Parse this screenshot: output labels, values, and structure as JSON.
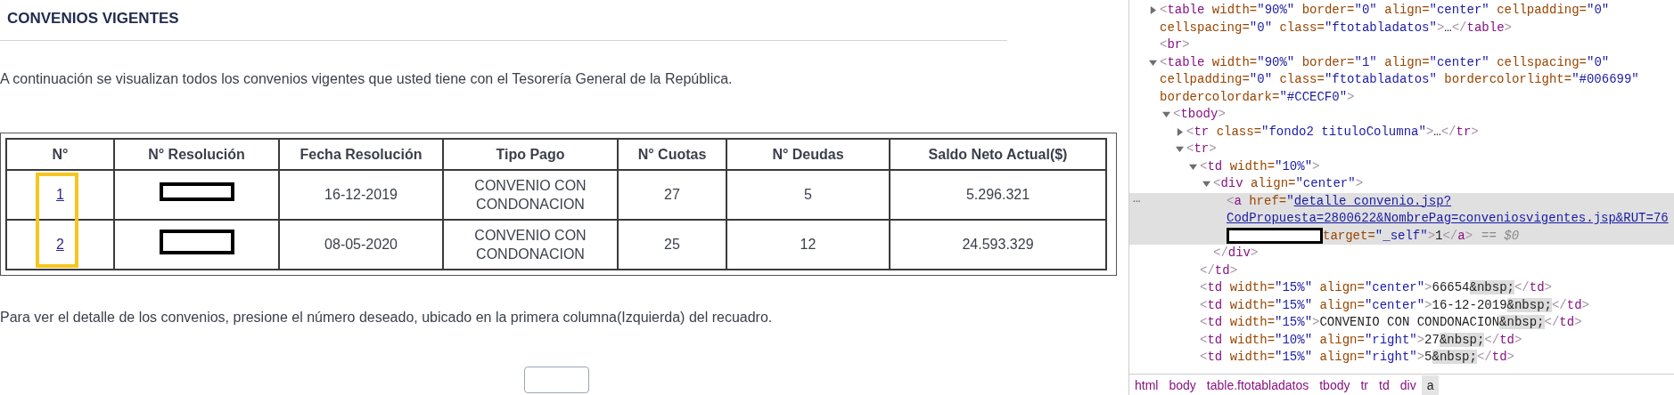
{
  "page": {
    "title": "CONVENIOS VIGENTES",
    "intro": "A continuación se visualizan todos los convenios vigentes que usted tiene con el Tesorería General de la República.",
    "table": {
      "columns": [
        "N°",
        "N° Resolución",
        "Fecha Resolución",
        "Tipo Pago",
        "N° Cuotas",
        "N° Deudas",
        "Saldo Neto Actual($)"
      ],
      "rows": [
        {
          "number": "1",
          "resolution_redacted": true,
          "date": "16-12-2019",
          "payment_type": "CONVENIO CON CONDONACION",
          "installments": "27",
          "debts": "5",
          "balance": "5.296.321"
        },
        {
          "number": "2",
          "resolution_redacted": true,
          "date": "08-05-2020",
          "payment_type": "CONVENIO CON CONDONACION",
          "installments": "25",
          "debts": "12",
          "balance": "24.593.329"
        }
      ],
      "first_column_highlighted": true
    },
    "note": "Para ver el detalle de los convenios, presione el número deseado, ubicado en la primera columna(Izquierda) del recuadro."
  },
  "devtools": {
    "tree": [
      {
        "kind": "element",
        "lines": [
          "<table width=\"90%\" border=\"0\" align=\"center\" cellpadding=\"0\"",
          "cellspacing=\"0\" class=\"ftotabladatos\">…</table>"
        ],
        "expanded": false,
        "selected": false
      },
      {
        "kind": "element",
        "lines": [
          "<br>"
        ],
        "selected": false
      },
      {
        "kind": "element",
        "lines": [
          "<table width=\"90%\" border=\"1\" align=\"center\" cellspacing=\"0\"",
          "cellpadding=\"0\" class=\"ftotabladatos\" bordercolorlight=\"#006699\"",
          "bordercolordark=\"#CCECF0\">"
        ],
        "expanded": true,
        "selected": false,
        "children": [
          {
            "kind": "element",
            "lines": [
              "<tbody>"
            ],
            "expanded": true,
            "selected": false,
            "children": [
              {
                "kind": "element",
                "lines": [
                  "<tr class=\"fondo2 tituloColumna\">…</tr>"
                ],
                "expanded": false,
                "selected": false
              },
              {
                "kind": "element",
                "lines": [
                  "<tr>"
                ],
                "expanded": true,
                "selected": false,
                "children": [
                  {
                    "kind": "element",
                    "lines": [
                      "<td width=\"10%\">"
                    ],
                    "expanded": true,
                    "selected": false,
                    "close": "</td>",
                    "children": [
                      {
                        "kind": "element",
                        "lines": [
                          "<div align=\"center\">"
                        ],
                        "expanded": true,
                        "selected": false,
                        "close": "</div>",
                        "children": [
                          {
                            "kind": "link",
                            "gutter_marker": "…",
                            "before": "<a href=\"",
                            "link_lines": [
                              "detalle_convenio.jsp?",
                              "CodPropuesta=2800622&NombrePag=conveniosvigentes.jsp&RUT=76"
                            ],
                            "redacted": true,
                            "after": "target=\"_self\">1</a>",
                            "console_ref": "== $0",
                            "selected": true
                          }
                        ]
                      }
                    ]
                  },
                  {
                    "kind": "element",
                    "lines": [
                      "<td width=\"15%\" align=\"center\">66654&nbsp;</td>"
                    ],
                    "selected": false
                  },
                  {
                    "kind": "element",
                    "lines": [
                      "<td width=\"15%\" align=\"center\">16-12-2019&nbsp;</td>"
                    ],
                    "selected": false
                  },
                  {
                    "kind": "element",
                    "lines": [
                      "<td width=\"15%\">CONVENIO CON CONDONACION&nbsp;</td>"
                    ],
                    "selected": false
                  },
                  {
                    "kind": "element",
                    "lines": [
                      "<td width=\"10%\" align=\"right\">27&nbsp;</td>"
                    ],
                    "selected": false
                  },
                  {
                    "kind": "element",
                    "lines": [
                      "<td width=\"15%\" align=\"right\">5&nbsp;</td>"
                    ],
                    "selected": false
                  }
                ]
              }
            ]
          }
        ]
      }
    ],
    "breadcrumbs": [
      {
        "label": "html",
        "selected": false
      },
      {
        "label": "body",
        "selected": false
      },
      {
        "label": "table.ftotabladatos",
        "selected": false
      },
      {
        "label": "tbody",
        "selected": false
      },
      {
        "label": "tr",
        "selected": false
      },
      {
        "label": "td",
        "selected": false
      },
      {
        "label": "div",
        "selected": false
      },
      {
        "label": "a",
        "selected": true
      }
    ]
  }
}
